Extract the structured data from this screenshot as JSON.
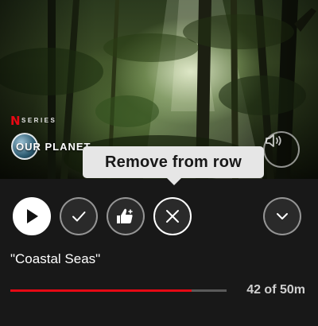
{
  "thumbnail": {
    "brand_logo": "N",
    "badge": "SERIES",
    "show_title": "OUR PLANET"
  },
  "tooltip": {
    "text": "Remove from row"
  },
  "controls": {
    "play_icon": "play-icon",
    "add_icon": "check-icon",
    "rate_icon": "thumbs-up-icon",
    "remove_icon": "close-icon",
    "more_icon": "chevron-down-icon",
    "mute_icon": "speaker-icon"
  },
  "episode": {
    "title": "\"Coastal Seas\""
  },
  "progress": {
    "fraction": 0.84,
    "text": "42 of 50m"
  },
  "colors": {
    "accent_red": "#e50914",
    "background": "#181818",
    "tooltip_bg": "#e6e6e6"
  }
}
